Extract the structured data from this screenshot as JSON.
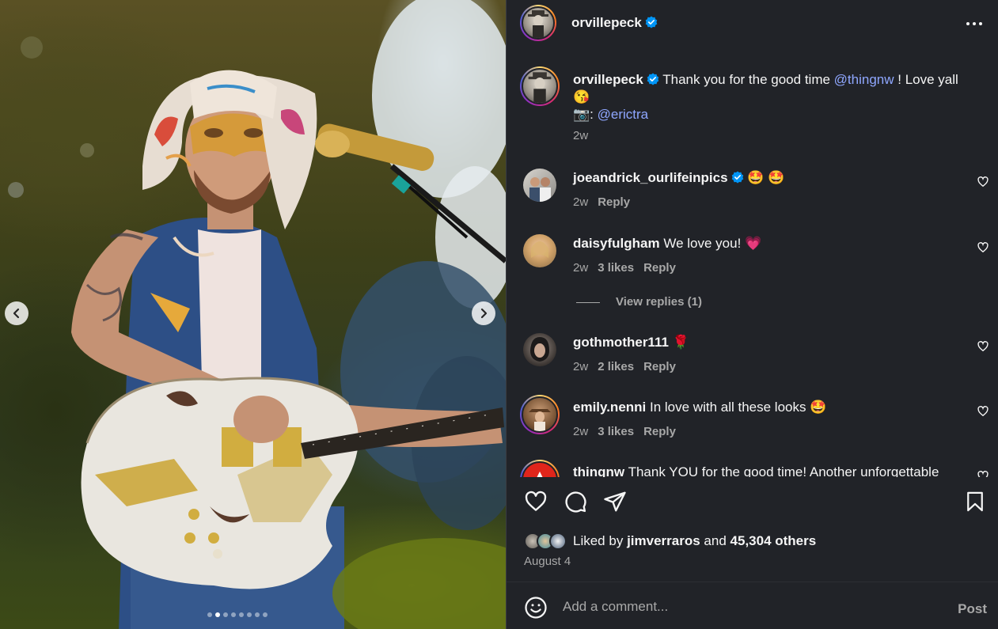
{
  "photo": {
    "carousel_count": 8,
    "active_index": 1,
    "prev_icon": "chevron-left-icon",
    "next_icon": "chevron-right-icon"
  },
  "header": {
    "username": "orvillepeck",
    "verified": true,
    "more_icon": "more-options-icon"
  },
  "caption": {
    "username": "orvillepeck",
    "text_before": "Thank you for the good time",
    "mention1": "@thingnw",
    "text_after": "! Love yall",
    "emoji1": "😘",
    "camera": "📷",
    "camera_sep": ":",
    "mention2": "@erictra",
    "time": "2w"
  },
  "comments": [
    {
      "username": "joeandrick_ourlifeinpics",
      "verified": true,
      "text": "🤩 🤩",
      "time": "2w",
      "likes": "",
      "reply": "Reply"
    },
    {
      "username": "daisyfulgham",
      "verified": false,
      "text": "We love you! 💗",
      "time": "2w",
      "likes": "3 likes",
      "reply": "Reply"
    },
    {
      "username": "gothmother111",
      "verified": false,
      "text": "🌹",
      "time": "2w",
      "likes": "2 likes",
      "reply": "Reply"
    },
    {
      "username": "emily.nenni",
      "verified": false,
      "text": "In love with all these looks 🤩",
      "time": "2w",
      "likes": "3 likes",
      "reply": "Reply"
    },
    {
      "username": "thingnw",
      "verified": false,
      "text": "Thank YOU for the good time! Another unforgettable",
      "time": "",
      "likes": "",
      "reply": ""
    }
  ],
  "view_replies": "View replies (1)",
  "footer": {
    "liked_by_prefix": "Liked by",
    "liked_by_user": "jimverraros",
    "liked_by_and": "and",
    "liked_by_others": "45,304 others",
    "date": "August 4",
    "comment_placeholder": "Add a comment...",
    "post_label": "Post"
  },
  "colors": {
    "panel_bg": "#212328",
    "mention": "#8fa7ff",
    "verified": "#0095f6",
    "muted": "#a8a8a8"
  }
}
